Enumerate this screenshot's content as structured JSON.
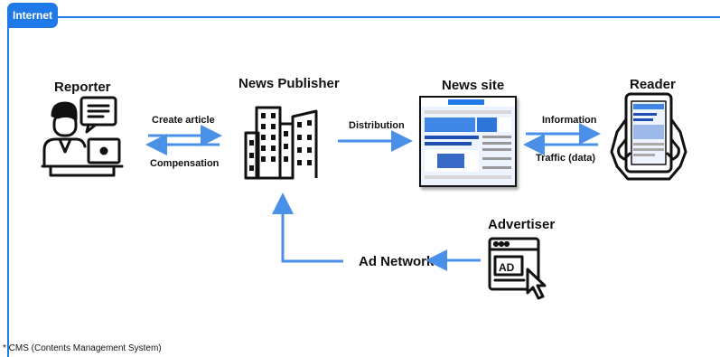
{
  "header": {
    "tag_label": "Internet"
  },
  "nodes": {
    "reporter": "Reporter",
    "publisher": "News Publisher",
    "site": "News site",
    "reader": "Reader",
    "advertiser": "Advertiser",
    "ad_network": "Ad Network"
  },
  "edges": {
    "create_article": "Create article",
    "compensation": "Compensation",
    "distribution": "Distribution",
    "information": "Information",
    "traffic": "Traffic (data)"
  },
  "icons": {
    "reporter": "reporter-at-laptop-icon",
    "publisher": "buildings-icon",
    "site": "news-website-screenshot",
    "reader": "tablet-in-hands-icon",
    "advertiser": "ad-window-click-icon"
  },
  "ad_text": "AD",
  "footnote": "* CMS (Contents Management System)",
  "colors": {
    "accent": "#1f7ae8",
    "arrow": "#4a8fe8",
    "ink": "#111111"
  }
}
